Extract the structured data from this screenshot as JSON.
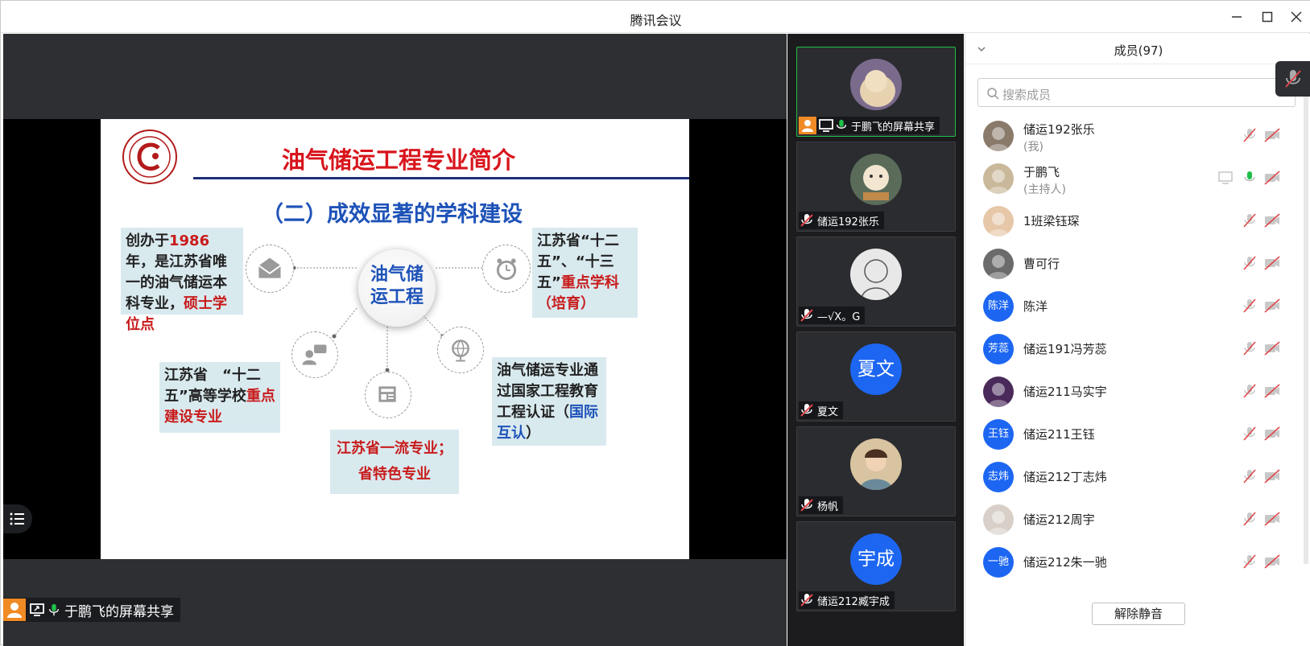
{
  "window": {
    "title": "腾讯会议"
  },
  "slide": {
    "title": "油气储运工程专业简介",
    "subtitle": "（二）成效显著的学科建设",
    "center": [
      "油气储",
      "运工程"
    ],
    "box1": {
      "pre": "创办于",
      "year": "1986",
      "mid": "年，是江苏省唯一的油气储运本科专业，",
      "red": "硕士学位点"
    },
    "box2": {
      "pre": "江苏省“十二五”、“十三五”",
      "red": "重点学科（培育）"
    },
    "box3": {
      "pre": "江苏省　“十二五”高等学校",
      "red": "重点建设专业"
    },
    "box4": {
      "line1": "江苏省一流专业；",
      "line2": "省特色专业"
    },
    "box5": {
      "pre": "油气储运专业通过国家工程教育工程认证（",
      "blue": "国际互认",
      "post": "）"
    }
  },
  "share_tag": {
    "label": "于鹏飞的屏幕共享"
  },
  "tiles": [
    {
      "name": "于鹏飞的屏幕共享",
      "kind": "photo"
    },
    {
      "name": "储运192张乐",
      "kind": "photo"
    },
    {
      "name": "—√X。G",
      "kind": "photo"
    },
    {
      "name": "夏文",
      "kind": "text",
      "avatar_text": "夏文"
    },
    {
      "name": "杨帆",
      "kind": "photo"
    },
    {
      "name": "储运212臧宇成",
      "kind": "text",
      "avatar_text": "宇成"
    }
  ],
  "members": {
    "header": "成员(97)",
    "search_placeholder": "搜索成员",
    "rows": [
      {
        "name": "储运192张乐",
        "sub": "(我)",
        "avatar": "photo"
      },
      {
        "name": "于鹏飞",
        "sub": "(主持人)",
        "avatar": "photo"
      },
      {
        "name": "1班梁钰琛",
        "avatar": "photo"
      },
      {
        "name": "曹可行",
        "avatar": "photo"
      },
      {
        "name": "陈洋",
        "avatar_text": "陈洋"
      },
      {
        "name": "储运191冯芳蕊",
        "avatar_text": "芳蕊"
      },
      {
        "name": "储运211马实宇",
        "avatar": "photo"
      },
      {
        "name": "储运211王钰",
        "avatar_text": "王钰"
      },
      {
        "name": "储运212丁志炜",
        "avatar_text": "志炜"
      },
      {
        "name": "储运212周宇",
        "avatar": "photo"
      },
      {
        "name": "储运212朱一驰",
        "avatar_text": "一驰"
      }
    ],
    "unmute_label": "解除静音"
  },
  "colors": {
    "accent": "#1c66f2",
    "speaking": "#1fbf4a",
    "muted": "#e0474b"
  }
}
